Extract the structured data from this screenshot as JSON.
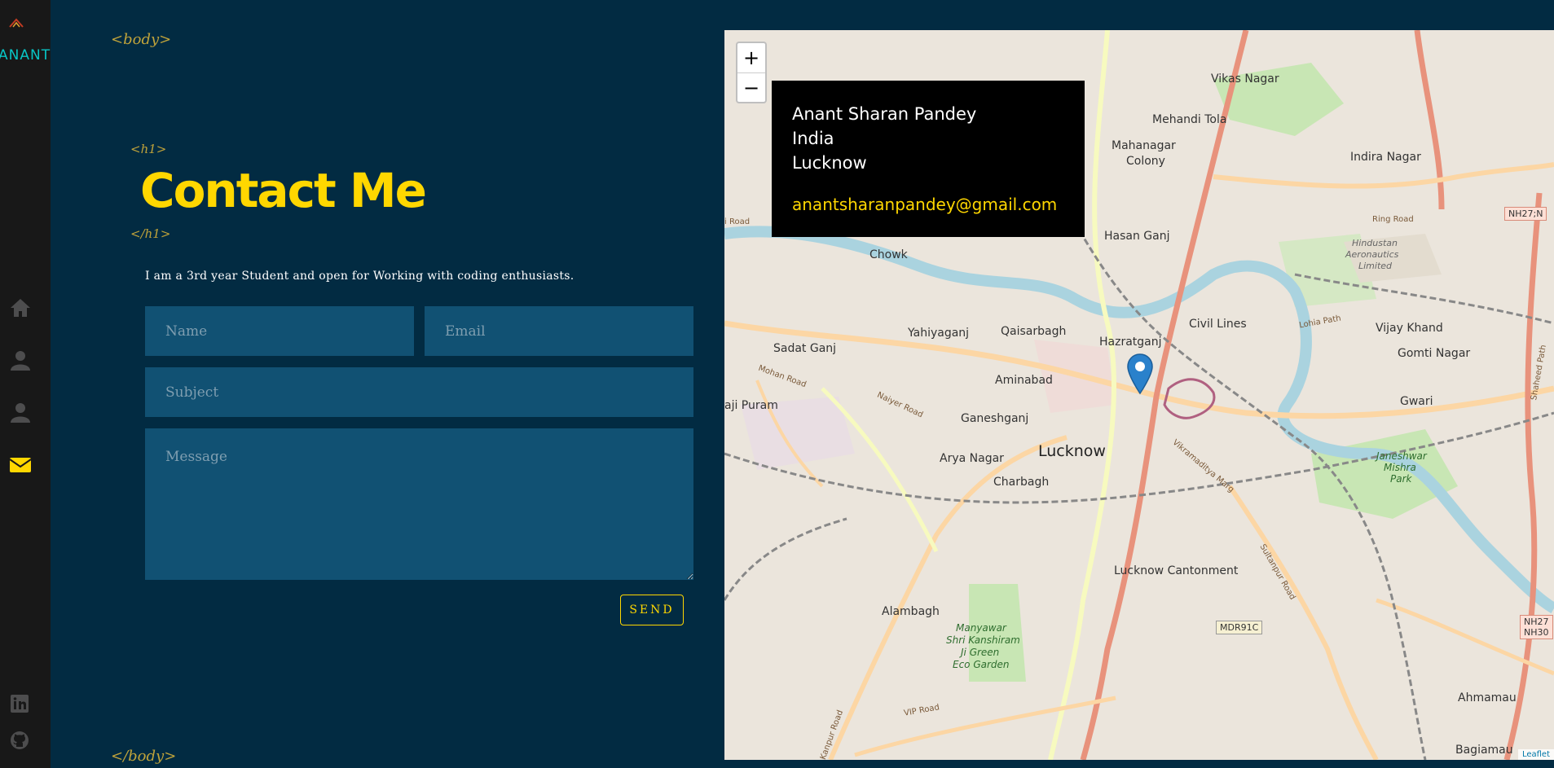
{
  "sidebar": {
    "logo_text": "ANANT",
    "nav": [
      {
        "icon": "home-icon",
        "active": false
      },
      {
        "icon": "user-icon",
        "active": false
      },
      {
        "icon": "user-icon",
        "active": false
      },
      {
        "icon": "envelope-icon",
        "active": true
      }
    ],
    "social": [
      "linkedin-icon",
      "github-icon"
    ],
    "icon_color": "#4d4d4e",
    "active_color": "#ffd700"
  },
  "decor": {
    "body_open": "<body>",
    "h1_open": "<h1>",
    "h1_close": "</h1>",
    "body_close": "</body>"
  },
  "contact": {
    "title": "Contact Me",
    "intro": "I am a 3rd year Student and open for Working with coding enthusiasts.",
    "form": {
      "name_placeholder": "Name",
      "email_placeholder": "Email",
      "subject_placeholder": "Subject",
      "message_placeholder": "Message",
      "send_label": "SEND"
    }
  },
  "map": {
    "zoom_in": "+",
    "zoom_out": "−",
    "info": {
      "name": "Anant Sharan Pandey",
      "country": "India",
      "city": "Lucknow",
      "email": "anantsharanpandey@gmail.com"
    },
    "attribution": "Leaflet",
    "labels": {
      "vikas_nagar": "Vikas Nagar",
      "mehandi_tola": "Mehandi Tola",
      "mahanagar": "Mahanagar",
      "colony": "Colony",
      "indira_nagar": "Indira Nagar",
      "hasan_ganj": "Hasan Ganj",
      "hindustan": "Hindustan",
      "aeronautics": "Aeronautics",
      "limited": "Limited",
      "chowk": "Chowk",
      "yahiyaganj": "Yahiyaganj",
      "qaisarbagh": "Qaisarbagh",
      "hazratganj": "Hazratganj",
      "civil_lines": "Civil Lines",
      "vijay_khand": "Vijay Khand",
      "gomti_nagar": "Gomti Nagar",
      "sadat_ganj": "Sadat Ganj",
      "aminabad": "Aminabad",
      "gwari": "Gwari",
      "aji_puram": "aji Puram",
      "ganeshganj": "Ganeshganj",
      "lucknow": "Lucknow",
      "arya_nagar": "Arya Nagar",
      "charbagh": "Charbagh",
      "janeshwar": "Janeshwar",
      "mishra": "Mishra",
      "park": "Park",
      "lucknow_cantonment": "Lucknow Cantonment",
      "alambagh": "Alambagh",
      "manyawar": "Manyawar",
      "shri_kanshiram": "Shri Kanshiram",
      "ji_green": "Ji Green",
      "eco_garden": "Eco Garden",
      "ahmamau": "Ahmamau",
      "bagiamau": "Bagiamau",
      "ring_road": "Ring Road",
      "mohan_road": "Mohan Road",
      "naiyer_road": "Naiyer Road",
      "lohia_path": "Lohia Path",
      "vip_road": "VIP Road",
      "sultanpur_road": "Sultanpur Road",
      "kanpur_road": "Kanpur Road",
      "shaheed_path": "Shaheed Path",
      "vikramaditya_marg": "Vikramaditya Marg",
      "i_road": "i Road"
    },
    "shields": {
      "nh27_top": "NH27;N",
      "mdr91c": "MDR91C",
      "nh27_nh30": "NH27\nNH30"
    }
  }
}
